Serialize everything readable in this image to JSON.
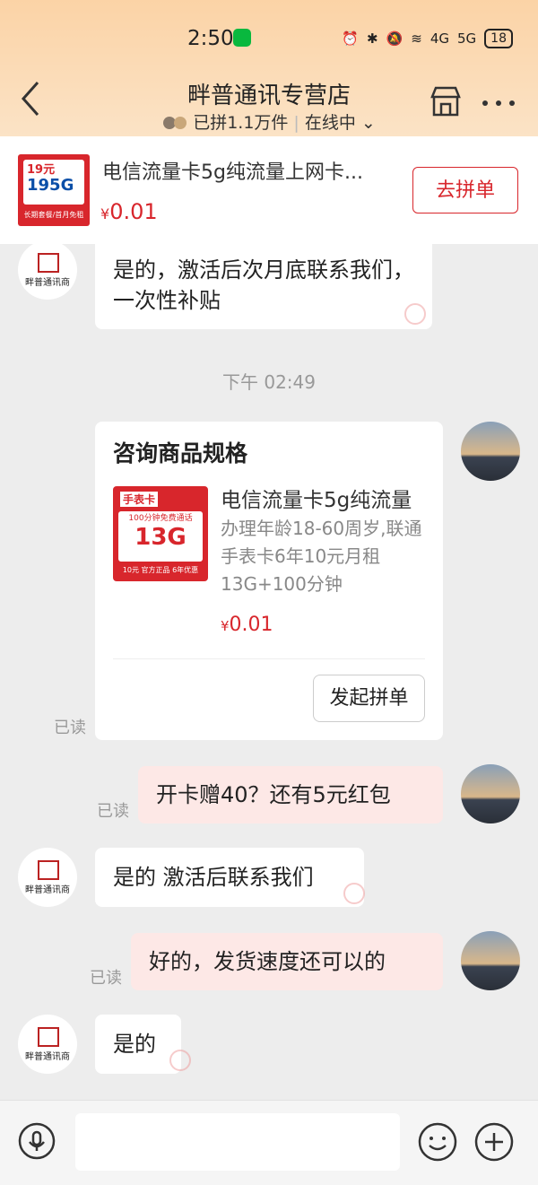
{
  "status": {
    "time": "2:50",
    "battery": "18",
    "net1": "4G",
    "net2": "5G"
  },
  "header": {
    "title": "畔普通讯专营店",
    "sales": "已拼1.1万件",
    "online": "在线中"
  },
  "product_bar": {
    "title": "电信流量卡5g纯流量上网卡...",
    "currency": "¥",
    "price": "0.01",
    "button": "去拼单",
    "thumb": {
      "price_tag": "19元",
      "big": "195G",
      "foot": "长期套餐/首月免租"
    }
  },
  "messages": {
    "m1": "是的，激活后次月底联系我们，一次性补贴",
    "timestamp": "下午 02:49",
    "card": {
      "title": "咨询商品规格",
      "name": "电信流量卡5g纯流量",
      "desc": "办理年龄18-60周岁,联通手表卡6年10元月租13G+100分钟",
      "currency": "¥",
      "price": "0.01",
      "button": "发起拼单",
      "thumb": {
        "tag": "手表卡",
        "line": "100分钟免费通话",
        "big": "13G",
        "foot": "10元 官方正品 6年优惠"
      }
    },
    "read1": "已读",
    "m2": "开卡赠40？还有5元红包",
    "read2": "已读",
    "m3": "是的 激活后联系我们",
    "m4": "好的，发货速度还可以的",
    "read3": "已读",
    "m5": "是的"
  },
  "shop_logo_text": "畔普通讯商",
  "icons": [
    "back-icon",
    "store-icon",
    "more-icon",
    "mic-icon",
    "emoji-icon",
    "plus-icon"
  ],
  "colors": {
    "accent": "#d8262c",
    "header_bg": "#fbd8ae",
    "bubble_right": "#fde8e6"
  }
}
